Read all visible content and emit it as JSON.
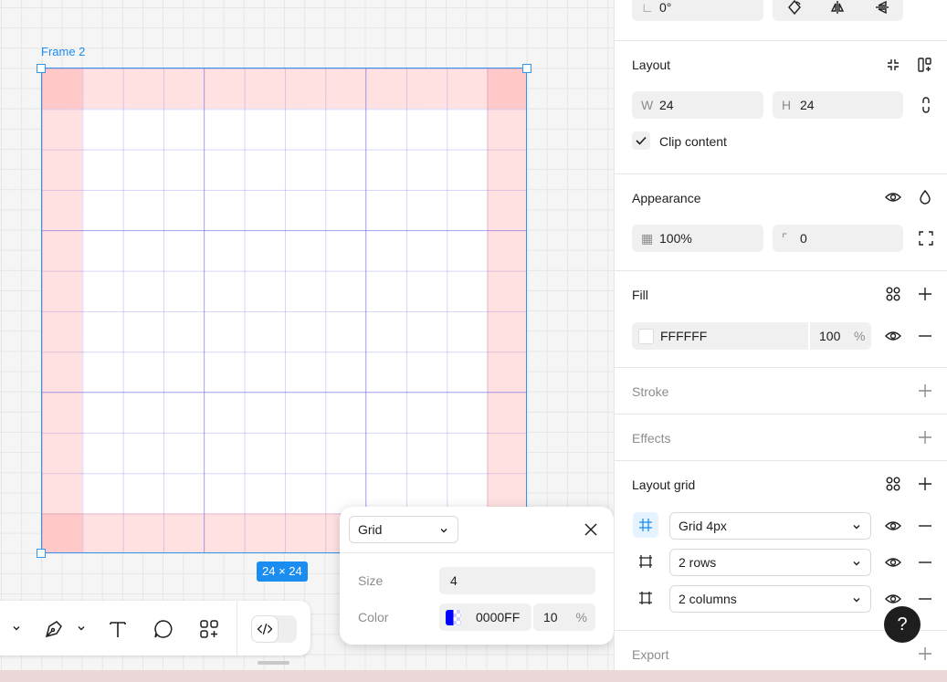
{
  "canvas": {
    "frame_name": "Frame 2",
    "frame_size": "24 × 24"
  },
  "popover": {
    "type": "Grid",
    "size_label": "Size",
    "size_value": "4",
    "color_label": "Color",
    "color_hex": "0000FF",
    "opacity": "10",
    "percent": "%"
  },
  "panel": {
    "rotation": "0°",
    "layout": {
      "title": "Layout",
      "w_prefix": "W",
      "w_value": "24",
      "h_prefix": "H",
      "h_value": "24",
      "clip_label": "Clip content"
    },
    "appearance": {
      "title": "Appearance",
      "opacity": "100%",
      "radius": "0"
    },
    "fill": {
      "title": "Fill",
      "hex": "FFFFFF",
      "opacity": "100",
      "percent": "%"
    },
    "stroke": {
      "title": "Stroke"
    },
    "effects": {
      "title": "Effects"
    },
    "layout_grid": {
      "title": "Layout grid",
      "items": [
        {
          "label": "Grid 4px"
        },
        {
          "label": "2 rows"
        },
        {
          "label": "2 columns"
        }
      ]
    },
    "export": {
      "title": "Export"
    }
  },
  "help": "?",
  "colors": {
    "accent": "#1b8cf0",
    "grid_color": "#0000FF"
  }
}
